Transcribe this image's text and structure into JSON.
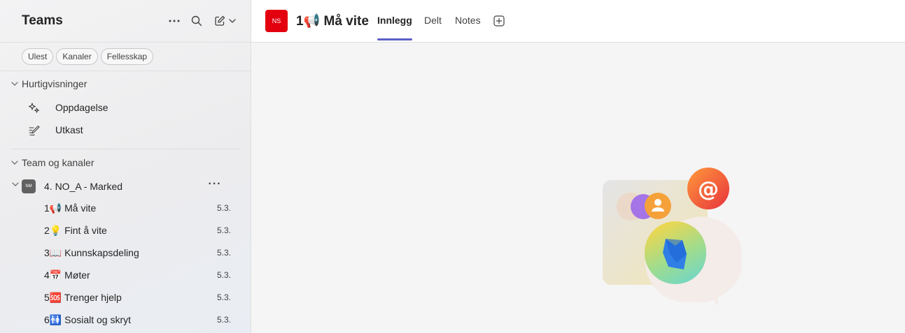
{
  "sidebar": {
    "title": "Teams",
    "icons": {
      "more": "more-horizontal-icon",
      "search": "search-icon",
      "compose": "compose-icon",
      "dropdown": "chevron-down-icon"
    },
    "filters": [
      "Ulest",
      "Kanaler",
      "Fellesskap"
    ],
    "quick_views": {
      "heading": "Hurtigvisninger",
      "items": [
        {
          "label": "Oppdagelse",
          "icon": "sparkle-icon"
        },
        {
          "label": "Utkast",
          "icon": "draft-pen-icon"
        }
      ]
    },
    "teams_section": {
      "heading": "Team og kanaler",
      "team": {
        "avatar_text": "NM",
        "name": "4. NO_A - Marked",
        "more": "···"
      },
      "channels": [
        {
          "name": "1📢 Må vite",
          "date": "5.3."
        },
        {
          "name": "2💡 Fint å vite",
          "date": "5.3."
        },
        {
          "name": "3📖 Kunnskapsdeling",
          "date": "5.3."
        },
        {
          "name": "4📅 Møter",
          "date": "5.3."
        },
        {
          "name": "5🆘 Trenger hjelp",
          "date": "5.3."
        },
        {
          "name": "6🚻 Sosialt og skryt",
          "date": "5.3."
        }
      ]
    }
  },
  "header": {
    "avatar_text": "NS",
    "avatar_color": "#e3000f",
    "channel_title": "1📢 Må vite",
    "tabs": [
      {
        "label": "Innlegg",
        "active": true
      },
      {
        "label": "Delt",
        "active": false
      },
      {
        "label": "Notes",
        "active": false
      }
    ],
    "accent_color": "#5b5fc7"
  }
}
